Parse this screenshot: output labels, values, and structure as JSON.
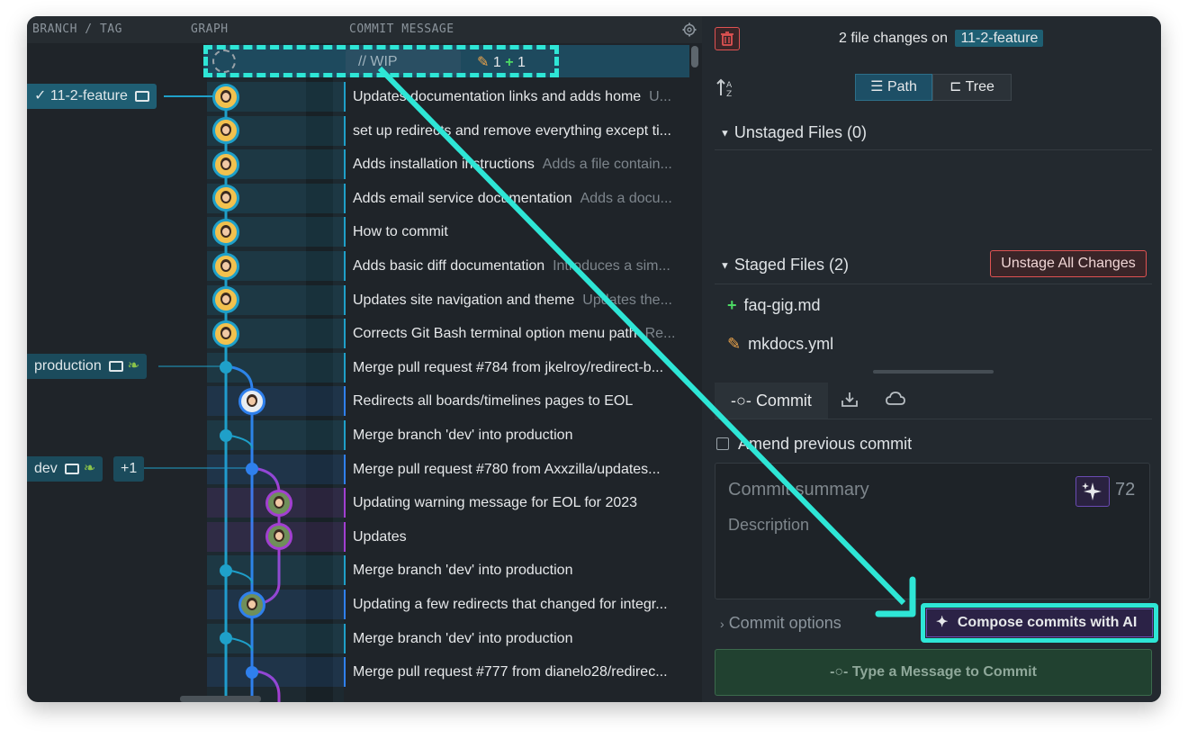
{
  "columns": {
    "branch_tag": "BRANCH / TAG",
    "graph": "GRAPH",
    "commit_message": "COMMIT MESSAGE"
  },
  "wip": {
    "label": "// WIP",
    "modified_count": "1",
    "added_count": "1"
  },
  "branches": {
    "feature": "11-2-feature",
    "production": "production",
    "dev": "dev",
    "dev_more": "+1"
  },
  "commits": [
    {
      "msg": "Updates documentation links and adds home",
      "desc": "U..."
    },
    {
      "msg": "set up redirects and remove everything except ti...",
      "desc": ""
    },
    {
      "msg": "Adds installation instructions",
      "desc": "Adds a file contain..."
    },
    {
      "msg": "Adds email service documentation",
      "desc": "Adds a docu..."
    },
    {
      "msg": "How to commit",
      "desc": ""
    },
    {
      "msg": "Adds basic diff documentation",
      "desc": "Introduces a sim..."
    },
    {
      "msg": "Updates site navigation and theme",
      "desc": "Updates the..."
    },
    {
      "msg": "Corrects Git Bash terminal option menu path",
      "desc": "Re..."
    },
    {
      "msg": "Merge pull request #784 from jkelroy/redirect-b...",
      "desc": ""
    },
    {
      "msg": "Redirects all boards/timelines pages to EOL",
      "desc": ""
    },
    {
      "msg": "Merge branch 'dev' into production",
      "desc": ""
    },
    {
      "msg": "Merge pull request #780 from Axxzilla/updates...",
      "desc": ""
    },
    {
      "msg": "Updating warning message for EOL for 2023",
      "desc": ""
    },
    {
      "msg": "Updates",
      "desc": ""
    },
    {
      "msg": "Merge branch 'dev' into production",
      "desc": ""
    },
    {
      "msg": "Updating a few redirects that changed for integr...",
      "desc": ""
    },
    {
      "msg": "Merge branch 'dev' into production",
      "desc": ""
    },
    {
      "msg": "Merge pull request #777 from dianelo28/redirec...",
      "desc": ""
    }
  ],
  "panel": {
    "summary_prefix": "2 file changes on",
    "branch": "11-2-feature",
    "view_path": "Path",
    "view_tree": "Tree",
    "unstaged_title": "Unstaged Files (0)",
    "staged_title": "Staged Files (2)",
    "unstage_all": "Unstage All Changes",
    "staged_files": [
      {
        "status": "added",
        "name": "faq-gig.md"
      },
      {
        "status": "modified",
        "name": "mkdocs.yml"
      }
    ],
    "tab_commit": "Commit",
    "amend_label": "Amend previous commit",
    "summary_placeholder": "Commit summary",
    "description_placeholder": "Description",
    "char_count": "72",
    "commit_options": "Commit options",
    "compose_ai": "Compose commits with AI",
    "commit_button": "Type a Message to Commit"
  },
  "colors": {
    "accent": "#1fa0c9",
    "merge_blue": "#2f80ed",
    "purple": "#a23fd1",
    "highlight": "#2ee6d6",
    "danger": "#e05252"
  }
}
